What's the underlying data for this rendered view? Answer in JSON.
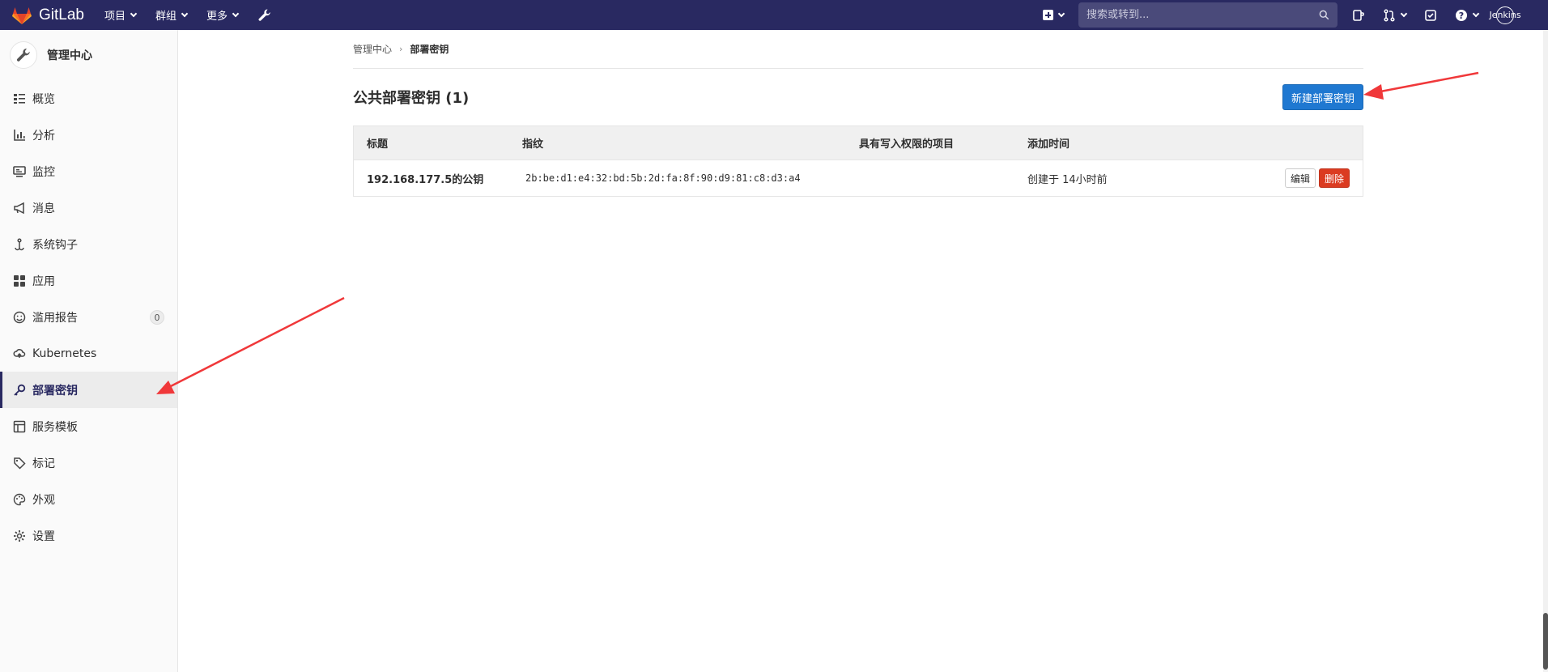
{
  "navbar": {
    "brand": "GitLab",
    "menu": [
      {
        "label": "项目"
      },
      {
        "label": "群组"
      },
      {
        "label": "更多"
      }
    ],
    "search_placeholder": "搜索或转到...",
    "user": "Jenkins"
  },
  "sidebar": {
    "title": "管理中心",
    "items": [
      {
        "label": "概览",
        "icon": "overview-icon"
      },
      {
        "label": "分析",
        "icon": "chart-icon"
      },
      {
        "label": "监控",
        "icon": "monitor-icon"
      },
      {
        "label": "消息",
        "icon": "bullhorn-icon"
      },
      {
        "label": "系统钩子",
        "icon": "hook-icon"
      },
      {
        "label": "应用",
        "icon": "applications-icon"
      },
      {
        "label": "滥用报告",
        "icon": "smiley-icon",
        "badge": "0"
      },
      {
        "label": "Kubernetes",
        "icon": "kubernetes-icon"
      },
      {
        "label": "部署密钥",
        "icon": "key-icon",
        "active": true
      },
      {
        "label": "服务模板",
        "icon": "template-icon"
      },
      {
        "label": "标记",
        "icon": "label-icon"
      },
      {
        "label": "外观",
        "icon": "palette-icon"
      },
      {
        "label": "设置",
        "icon": "settings-icon"
      }
    ]
  },
  "breadcrumb": {
    "parent": "管理中心",
    "current": "部署密钥"
  },
  "page": {
    "title": "公共部署密钥 (1)",
    "new_button": "新建部署密钥"
  },
  "table": {
    "headers": [
      "标题",
      "指纹",
      "具有写入权限的项目",
      "添加时间"
    ],
    "rows": [
      {
        "title": "192.168.177.5的公钥",
        "fingerprint": "2b:be:d1:e4:32:bd:5b:2d:fa:8f:90:d9:81:c8:d3:a4",
        "projects": "",
        "added": "创建于 14小时前",
        "edit_label": "编辑",
        "delete_label": "删除"
      }
    ]
  },
  "colors": {
    "navbar": "#292961",
    "primary": "#1f78d1",
    "danger": "#db3b21",
    "annotation_arrow": "#f0383a"
  }
}
